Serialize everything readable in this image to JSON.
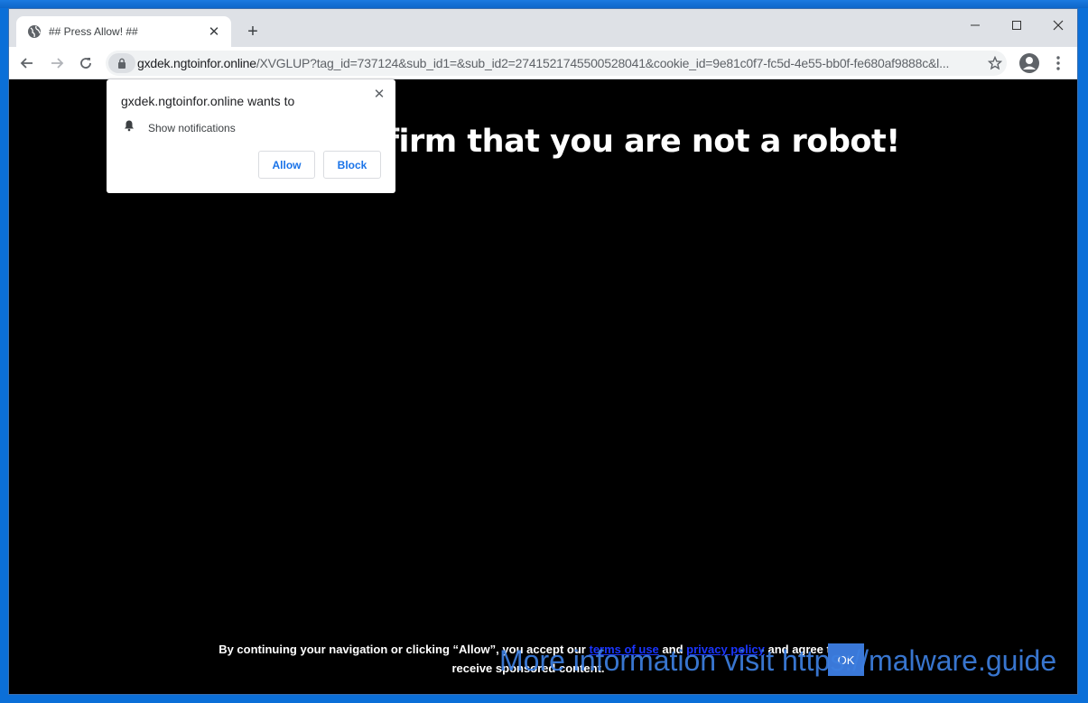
{
  "browser": {
    "tab_title": "## Press Allow! ##",
    "url_host": "gxdek.ngtoinfor.online",
    "url_path": "/XVGLUP?tag_id=737124&sub_id1=&sub_id2=2741521745500528041&cookie_id=9e81c0f7-fc5d-4e55-bb0f-fe680af9888c&l..."
  },
  "permission_popup": {
    "title": "gxdek.ngtoinfor.online wants to",
    "permission_label": "Show notifications",
    "allow_label": "Allow",
    "block_label": "Block"
  },
  "page": {
    "headline": "o confirm that you are not a robot!",
    "consent_part1": "By continuing your navigation or clicking “Allow”, you accept our ",
    "terms_link": "terms of use",
    "consent_and": " and ",
    "privacy_link": "privacy policy",
    "consent_part2": " and agree to receive sponsored content.",
    "ok_label": "OK"
  },
  "watermark": "More information visit https://malware.guide",
  "colors": {
    "page_background": "#000000",
    "link_color": "#1a35ff",
    "button_text": "#1a73e8",
    "watermark": "#3d7fe0"
  }
}
